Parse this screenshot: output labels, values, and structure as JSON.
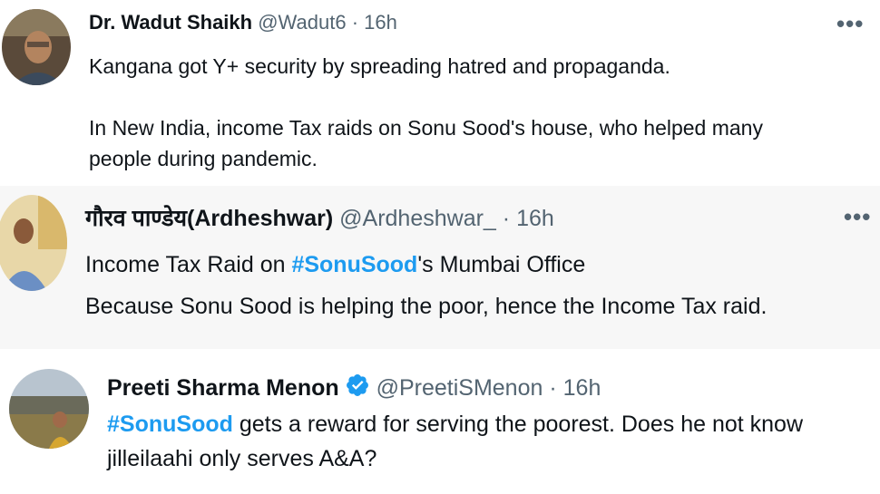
{
  "tweets": [
    {
      "name": "Dr. Wadut Shaikh",
      "handle": "@Wadut6",
      "separator": "·",
      "time": "16h",
      "more": "•••",
      "lines": [
        "Kangana got Y+ security by spreading hatred and propaganda.",
        "In New India, income Tax raids on Sonu Sood's house, who helped many",
        "people during pandemic."
      ]
    },
    {
      "name": "गौरव पाण्डेय(Ardheshwar)",
      "handle": "@Ardheshwar_",
      "separator": "·",
      "time": "16h",
      "more": "•••",
      "line1_prefix": "Income Tax Raid on ",
      "line1_hashtag": "#SonuSood",
      "line1_suffix": "'s Mumbai Office",
      "line2": "Because Sonu Sood is helping the poor, hence the Income Tax raid."
    },
    {
      "name": "Preeti Sharma Menon",
      "handle": "@PreetiSMenon",
      "separator": "·",
      "time": "16h",
      "hashtag": "#SonuSood",
      "line1_suffix": " gets a reward for serving the poorest. Does he not know",
      "line2": "jilleilaahi only serves A&A?"
    }
  ],
  "colors": {
    "hashtag": "#1d9bf0",
    "verified": "#1d9bf0",
    "secondary_text": "#536471",
    "highlight_background": "#f7f7f7"
  }
}
